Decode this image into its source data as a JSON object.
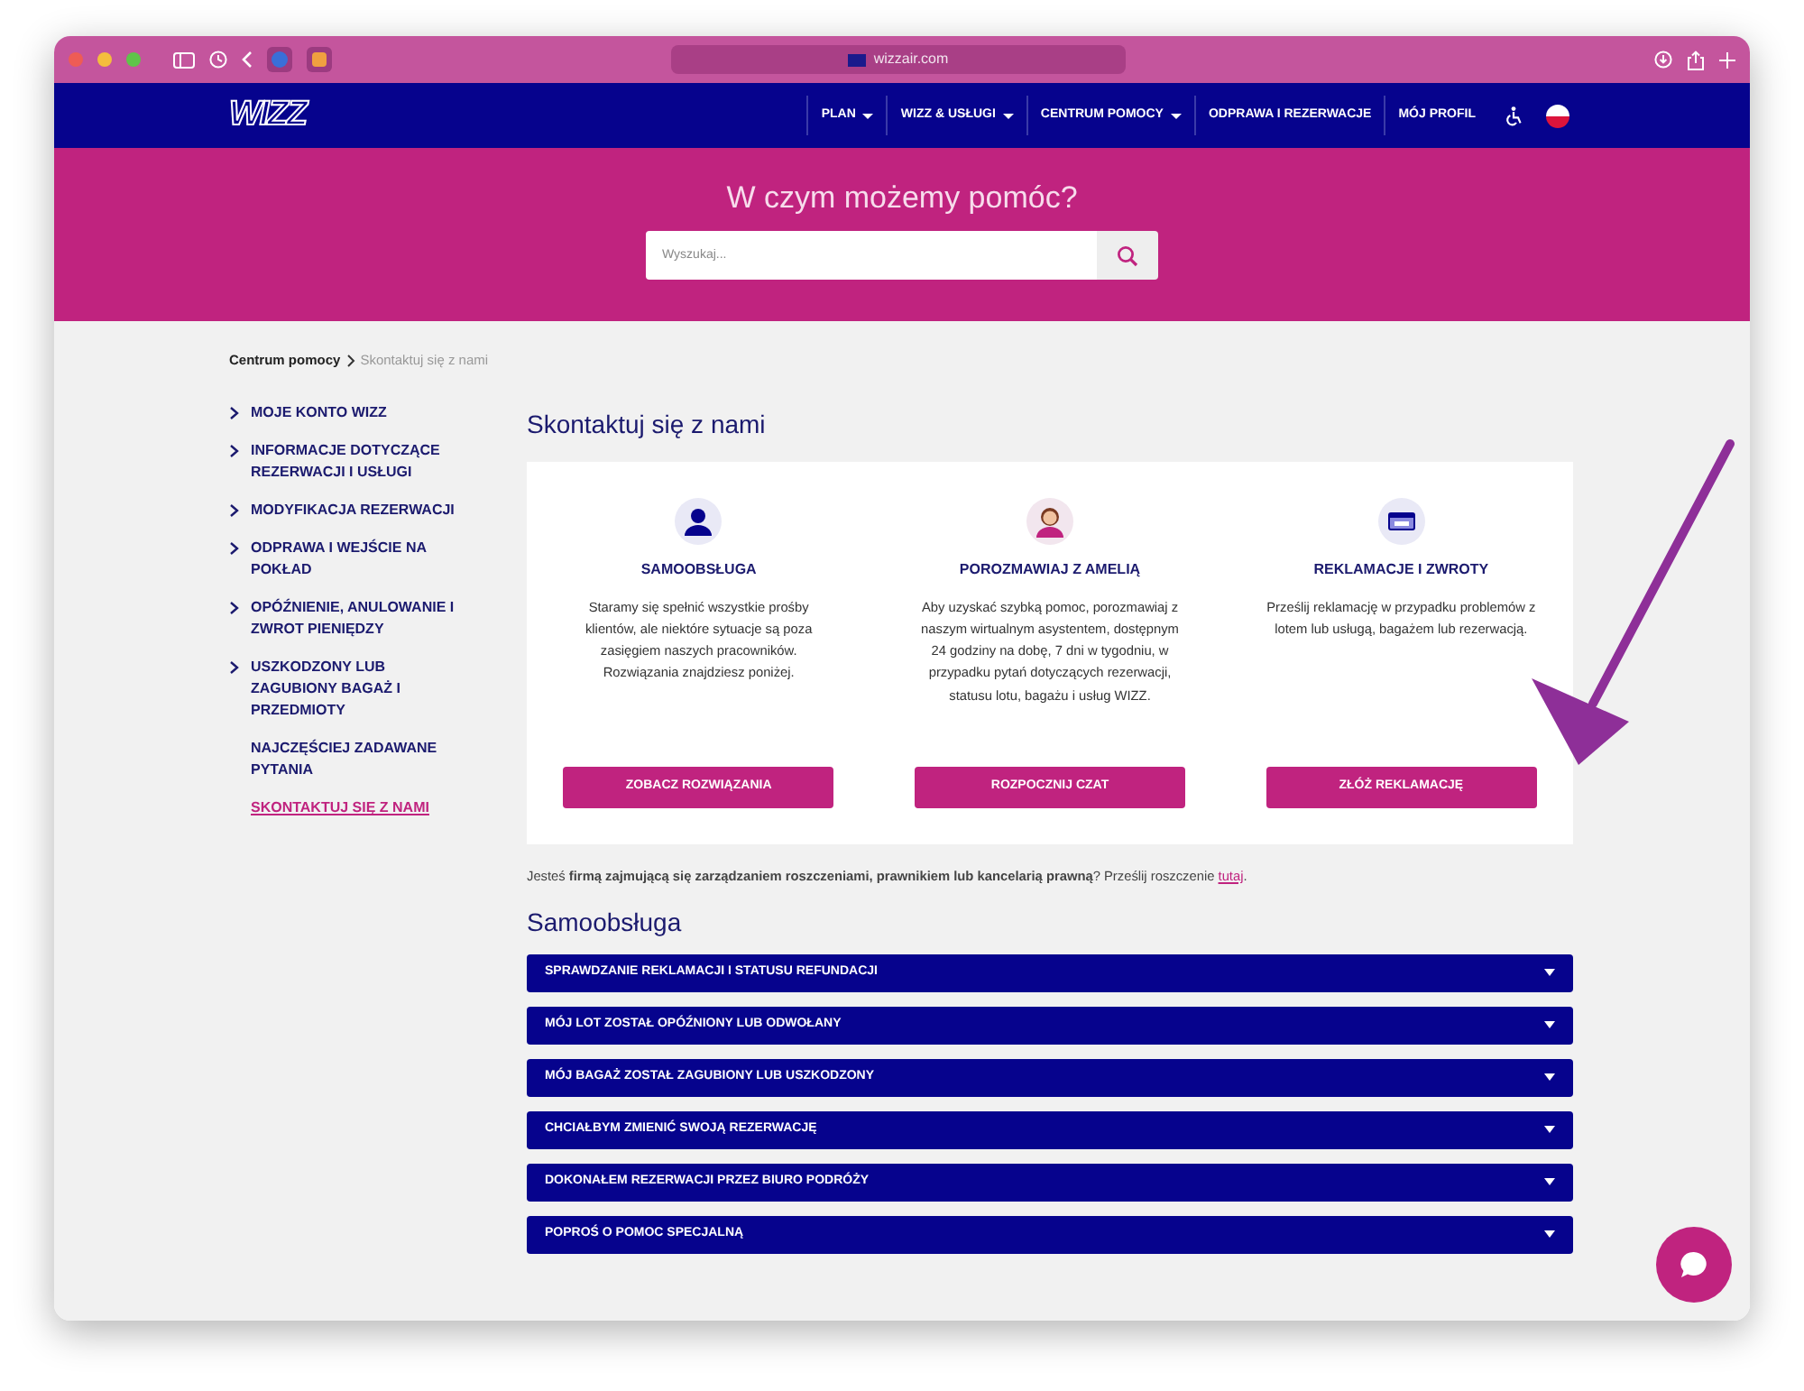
{
  "browser": {
    "url": "wizzair.com"
  },
  "nav": {
    "logo": "WIZZ",
    "items": [
      {
        "label": "PLAN",
        "dropdown": true
      },
      {
        "label": "WIZZ & USŁUGI",
        "dropdown": true
      },
      {
        "label": "CENTRUM POMOCY",
        "dropdown": true
      },
      {
        "label": "ODPRAWA I REZERWACJE",
        "dropdown": false
      },
      {
        "label": "MÓJ PROFIL",
        "dropdown": false
      }
    ]
  },
  "hero": {
    "title": "W czym możemy pomóc?",
    "search": {
      "placeholder": "Wyszukaj..."
    }
  },
  "breadcrumb": [
    {
      "label": "Centrum pomocy",
      "current": false
    },
    {
      "label": "Skontaktuj się z nami",
      "current": true
    }
  ],
  "sidebar": {
    "items": [
      {
        "label": "MOJE KONTO WIZZ",
        "kind": "category",
        "selected": false
      },
      {
        "label": "INFORMACJE DOTYCZĄCE REZERWACJI I USŁUGI",
        "kind": "category",
        "selected": false
      },
      {
        "label": "MODYFIKACJA REZERWACJI",
        "kind": "category",
        "selected": false
      },
      {
        "label": "ODPRAWA I WEJŚCIE NA POKŁAD",
        "kind": "category",
        "selected": false
      },
      {
        "label": "OPÓŹNIENIE, ANULOWANIE I ZWROT PIENIĘDZY",
        "kind": "category",
        "selected": false
      },
      {
        "label": "USZKODZONY LUB ZAGUBIONY BAGAŻ I PRZEDMIOTY",
        "kind": "category",
        "selected": false
      },
      {
        "label": "NAJCZĘŚCIEJ ZADAWANE PYTANIA",
        "kind": "link",
        "selected": false
      },
      {
        "label": "SKONTAKTUJ SIĘ Z NAMI",
        "kind": "link",
        "selected": true
      }
    ]
  },
  "contact": {
    "title": "Skontaktuj się z nami",
    "options": [
      {
        "kind": "self-service",
        "title": "SAMOOBSŁUGA",
        "text": "Staramy się spełnić wszystkie prośby klientów, ale niektóre sytuacje są poza zasięgiem naszych pracowników. Rozwiązania znajdziesz poniżej.",
        "button": "ZOBACZ ROZWIĄZANIA"
      },
      {
        "kind": "chat",
        "title": "POROZMAWIAJ Z AMELIĄ",
        "text": "Aby uzyskać szybką pomoc, porozmawiaj z naszym wirtualnym asystentem, dostępnym 24 godziny na dobę, 7 dni w tygodniu, w przypadku pytań dotyczących rezerwacji, statusu lotu, bagażu i usług WIZZ.",
        "button": "ROZPOCZNIJ CZAT"
      },
      {
        "kind": "claims",
        "title": "REKLAMACJE I ZWROTY",
        "text": "Prześlij reklamację w przypadku problemów z lotem lub usługą, bagażem lub rezerwacją.",
        "button": "ZŁÓŻ REKLAMACJĘ"
      }
    ]
  },
  "claims_note": {
    "text": "Jesteś **firmą zajmującą się zarządzaniem roszczeniami, prawnikiem lub kancelarią prawną**? Prześlij roszczenie ",
    "link": "tutaj",
    "end": "."
  },
  "self_service": {
    "title": "Samoobsługa",
    "items": [
      {
        "label": "SPRAWDZANIE REKLAMACJI I STATUSU REFUNDACJI",
        "expanded": false
      },
      {
        "label": "MÓJ LOT ZOSTAŁ OPÓŹNIONY LUB ODWOŁANY",
        "expanded": false
      },
      {
        "label": "MÓJ BAGAŻ ZOSTAŁ ZAGUBIONY LUB USZKODZONY",
        "expanded": false
      },
      {
        "label": "CHCIAŁBYM ZMIENIĆ SWOJĄ REZERWACJĘ",
        "expanded": false
      },
      {
        "label": "DOKONAŁEM REZERWACJI PRZEZ BIURO PODRÓŻY",
        "expanded": false
      },
      {
        "label": "POPROŚ O POMOC SPECJALNĄ",
        "expanded": false
      }
    ]
  }
}
